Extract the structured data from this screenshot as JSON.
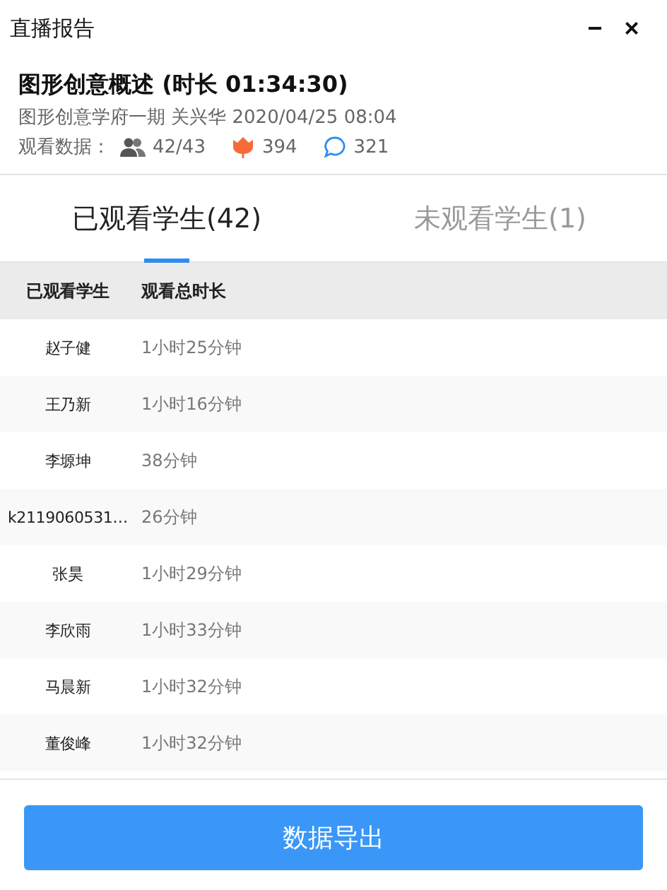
{
  "window": {
    "title": "直播报告",
    "minimize": "−",
    "close": "×"
  },
  "header": {
    "title": "图形创意概述 (时长 01:34:30)",
    "subtitle": "图形创意学府一期 关兴华 2020/04/25 08:04",
    "stats_label": "观看数据：",
    "viewers": "42/43",
    "likes": "394",
    "comments": "321"
  },
  "tabs": [
    {
      "label": "已观看学生(42)",
      "selected": true
    },
    {
      "label": "未观看学生(1)",
      "selected": false
    }
  ],
  "table": {
    "columns": [
      "已观看学生",
      "观看总时长"
    ],
    "rows": [
      [
        "赵子健",
        "1小时25分钟"
      ],
      [
        "王乃新",
        "1小时16分钟"
      ],
      [
        "李塬坤",
        "38分钟"
      ],
      [
        "k2119060531…",
        "26分钟"
      ],
      [
        "张昊",
        "1小时29分钟"
      ],
      [
        "李欣雨",
        "1小时33分钟"
      ],
      [
        "马晨新",
        "1小时32分钟"
      ],
      [
        "董俊峰",
        "1小时32分钟"
      ]
    ]
  },
  "export_button": "数据导出"
}
